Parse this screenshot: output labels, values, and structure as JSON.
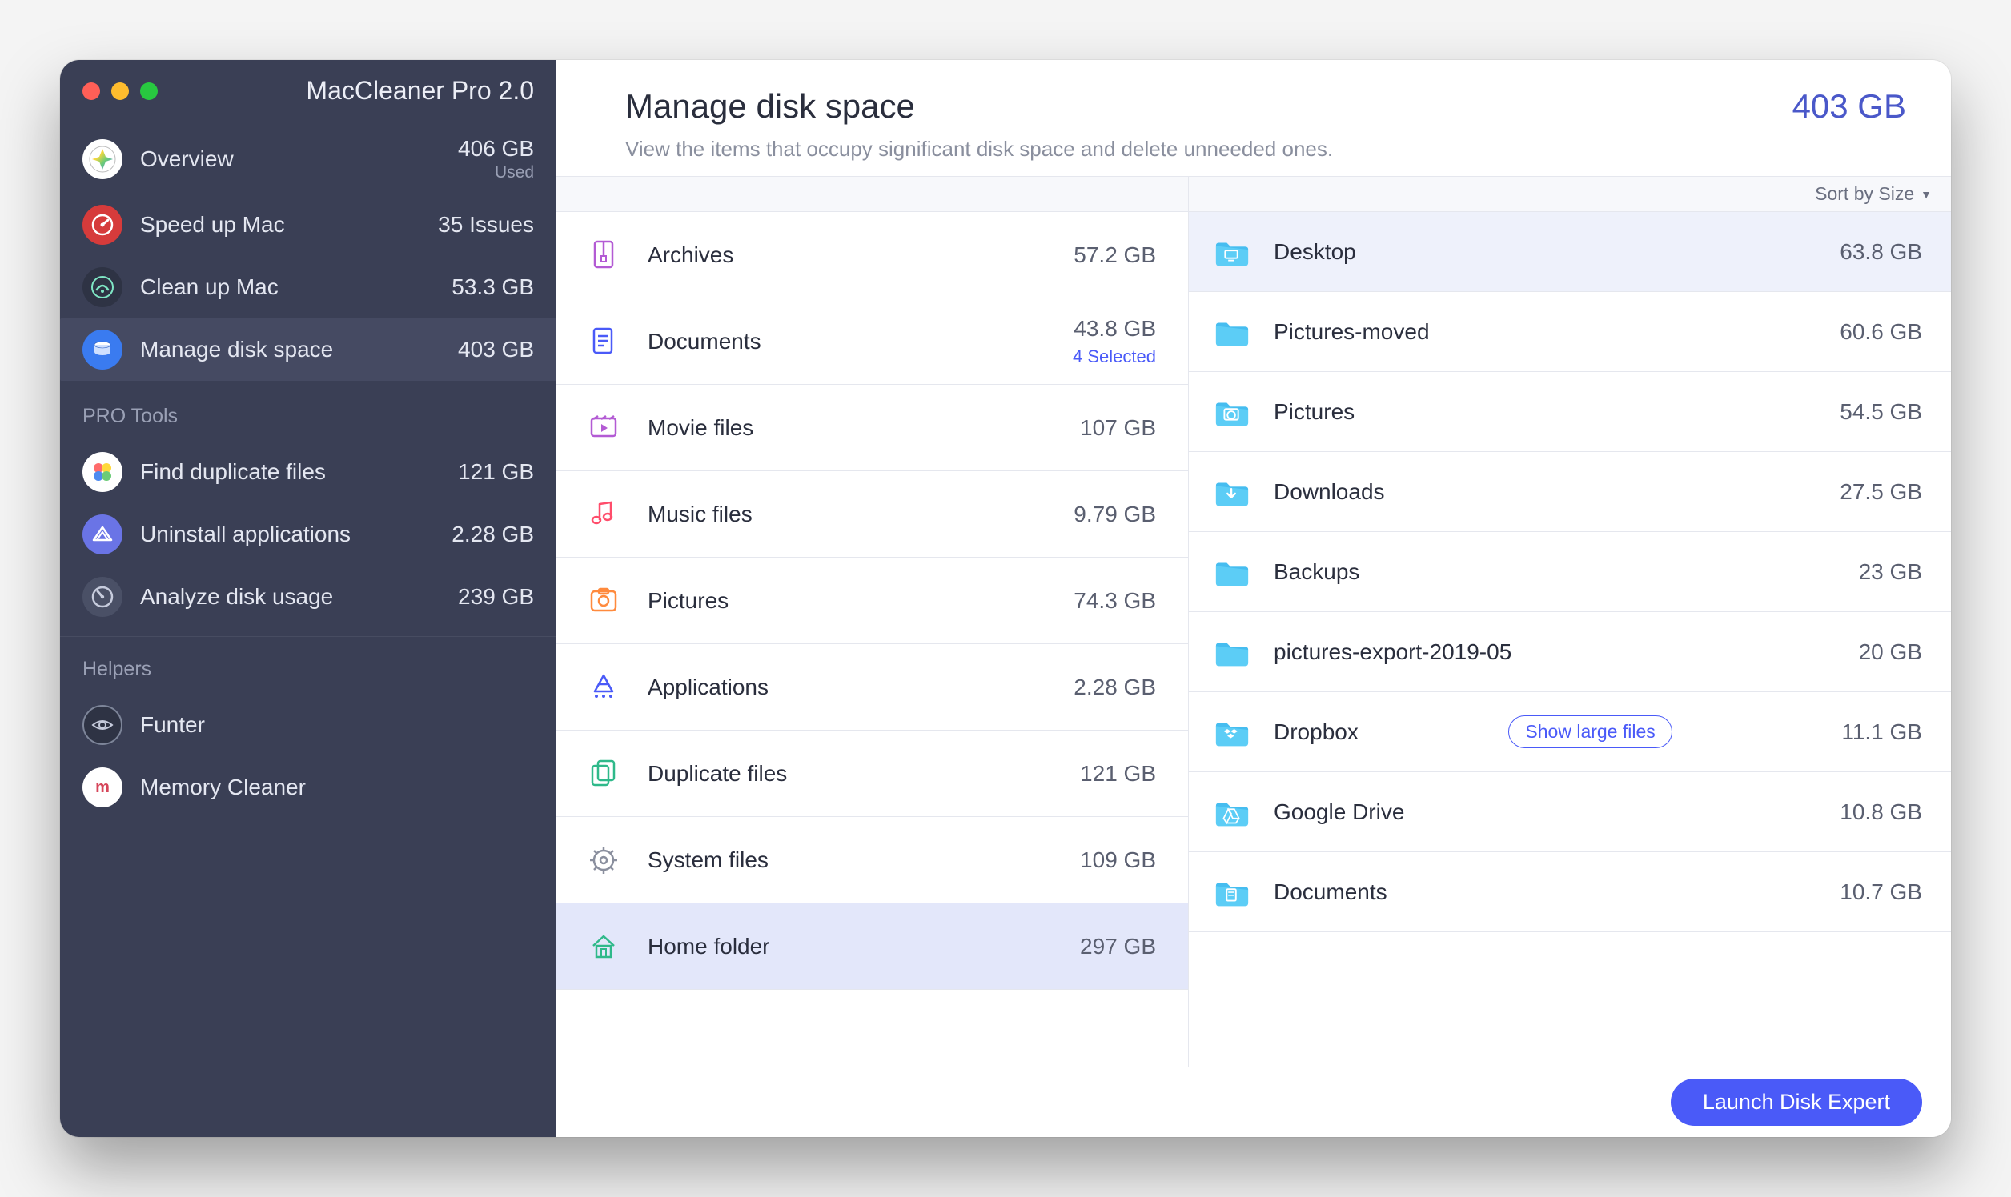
{
  "app": {
    "title": "MacCleaner Pro 2.0"
  },
  "sidebar": {
    "nav": [
      {
        "label": "Overview",
        "value": "406 GB",
        "sub": "Used"
      },
      {
        "label": "Speed up Mac",
        "value": "35 Issues"
      },
      {
        "label": "Clean up Mac",
        "value": "53.3 GB"
      },
      {
        "label": "Manage disk space",
        "value": "403 GB",
        "active": true
      }
    ],
    "tools_header": "PRO Tools",
    "tools": [
      {
        "label": "Find duplicate files",
        "value": "121 GB"
      },
      {
        "label": "Uninstall applications",
        "value": "2.28 GB"
      },
      {
        "label": "Analyze disk usage",
        "value": "239 GB"
      }
    ],
    "helpers_header": "Helpers",
    "helpers": [
      {
        "label": "Funter"
      },
      {
        "label": "Memory Cleaner"
      }
    ]
  },
  "header": {
    "title": "Manage disk space",
    "value": "403 GB",
    "subtitle": "View the items that occupy significant disk space and delete unneeded ones."
  },
  "categories": [
    {
      "label": "Archives",
      "value": "57.2 GB"
    },
    {
      "label": "Documents",
      "value": "43.8 GB",
      "badge": "4 Selected"
    },
    {
      "label": "Movie files",
      "value": "107 GB"
    },
    {
      "label": "Music files",
      "value": "9.79 GB"
    },
    {
      "label": "Pictures",
      "value": "74.3 GB"
    },
    {
      "label": "Applications",
      "value": "2.28 GB"
    },
    {
      "label": "Duplicate files",
      "value": "121 GB"
    },
    {
      "label": "System files",
      "value": "109 GB"
    },
    {
      "label": "Home folder",
      "value": "297 GB",
      "selected": true
    }
  ],
  "sort": {
    "label": "Sort by Size"
  },
  "folders": [
    {
      "label": "Desktop",
      "value": "63.8 GB",
      "selected": true,
      "variant": "desktop"
    },
    {
      "label": "Pictures-moved",
      "value": "60.6 GB"
    },
    {
      "label": "Pictures",
      "value": "54.5 GB",
      "variant": "pictures"
    },
    {
      "label": "Downloads",
      "value": "27.5 GB",
      "variant": "downloads"
    },
    {
      "label": "Backups",
      "value": "23 GB"
    },
    {
      "label": "pictures-export-2019-05",
      "value": "20 GB"
    },
    {
      "label": "Dropbox",
      "value": "11.1 GB",
      "action": "Show large files",
      "variant": "dropbox"
    },
    {
      "label": "Google Drive",
      "value": "10.8 GB",
      "variant": "gdrive"
    },
    {
      "label": "Documents",
      "value": "10.7 GB",
      "variant": "documents"
    }
  ],
  "footer": {
    "cta": "Launch Disk Expert"
  }
}
